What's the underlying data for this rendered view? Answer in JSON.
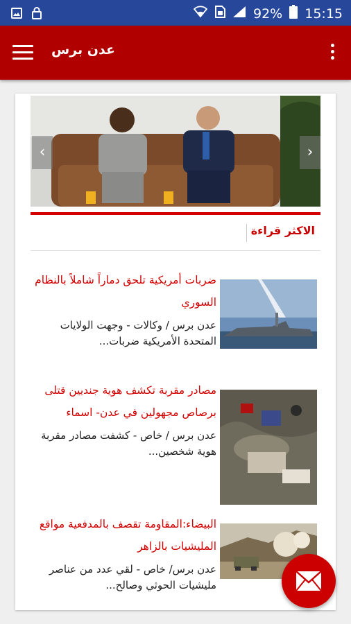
{
  "status_bar": {
    "battery": "92%",
    "time": "15:15"
  },
  "app_bar": {
    "title": "عدن برس"
  },
  "slider": {
    "prev_glyph": "‹",
    "next_glyph": "›"
  },
  "section": {
    "most_read": "الاكثر قراءة"
  },
  "articles": [
    {
      "title": "ضربات أمريكية تلحق دماراً شاملاً بالنظام السوري",
      "excerpt": "عدن برس / وكالات - وجهت الولايات المتحدة الأمريكية ضربات..."
    },
    {
      "title": "مصادر مقربة تكشف هوية جنديين قتلى برصاص مجهولين في عدن- اسماء",
      "excerpt": "عدن برس / خاص - كشفت مصادر مقربة هوية شخصين..."
    },
    {
      "title": "البيضاء:المقاومة تقصف بالمدفعية مواقع المليشيات بالزاهر",
      "excerpt": "عدن برس/ خاص - لقي عدد من عناصر مليشيات الحوثي وصالح..."
    }
  ],
  "colors": {
    "status_bar": "#27479a",
    "app_bar": "#b10000",
    "accent_red": "#d10000"
  },
  "icons": [
    "image-icon",
    "lock-icon",
    "wifi-icon",
    "sim-icon",
    "signal-icon",
    "battery-icon",
    "menu-icon",
    "more-vert-icon",
    "mail-icon"
  ]
}
